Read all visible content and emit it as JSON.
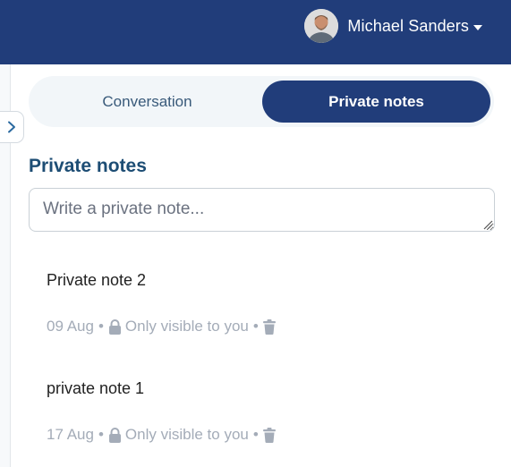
{
  "header": {
    "user_name": "Michael Sanders",
    "bg_color": "#213d7a"
  },
  "tabs": [
    {
      "label": "Conversation",
      "active": false
    },
    {
      "label": "Private notes",
      "active": true
    }
  ],
  "section": {
    "title": "Private notes",
    "input_placeholder": "Write a private note..."
  },
  "notes": [
    {
      "text": "Private note 2",
      "date": "09 Aug",
      "visibility": "Only visible to you",
      "sep": "•"
    },
    {
      "text": "private note 1",
      "date": "17 Aug",
      "visibility": "Only visible to you",
      "sep": "•"
    }
  ],
  "icons": [
    "avatar",
    "caret-down-icon",
    "chevron-right-icon",
    "lock-icon",
    "trash-icon"
  ]
}
